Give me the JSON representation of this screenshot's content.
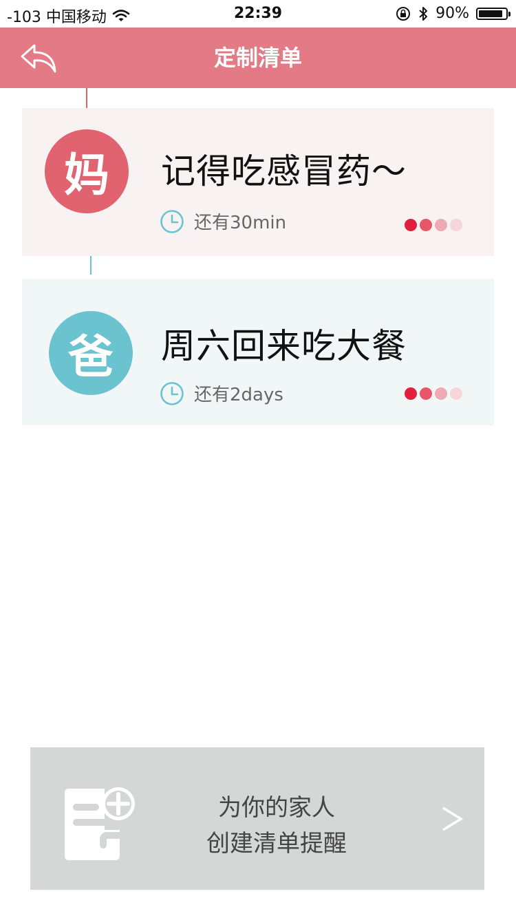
{
  "status_bar": {
    "carrier": "-103 中国移动",
    "time": "22:39",
    "battery_percent": "90%",
    "battery_level": 0.9
  },
  "header": {
    "title": "定制清单"
  },
  "reminders": [
    {
      "avatar_text": "妈",
      "title": "记得吃感冒药～",
      "remaining": "还有30min",
      "avatar_color": "#e0636f",
      "card_color": "#f9f2f2",
      "priority_level": 2,
      "priority_max": 4
    },
    {
      "avatar_text": "爸",
      "title": "周六回来吃大餐",
      "remaining": "还有2days",
      "avatar_color": "#6cc3d0",
      "card_color": "#f1f6f7",
      "priority_level": 2,
      "priority_max": 4
    }
  ],
  "cta": {
    "line1": "为你的家人",
    "line2": "创建清单提醒",
    "arrow": ">"
  },
  "colors": {
    "accent": "#e47a86",
    "priority_dots": [
      "#e0203c",
      "#e8566a",
      "#eeaab4",
      "#f5d6db"
    ]
  }
}
